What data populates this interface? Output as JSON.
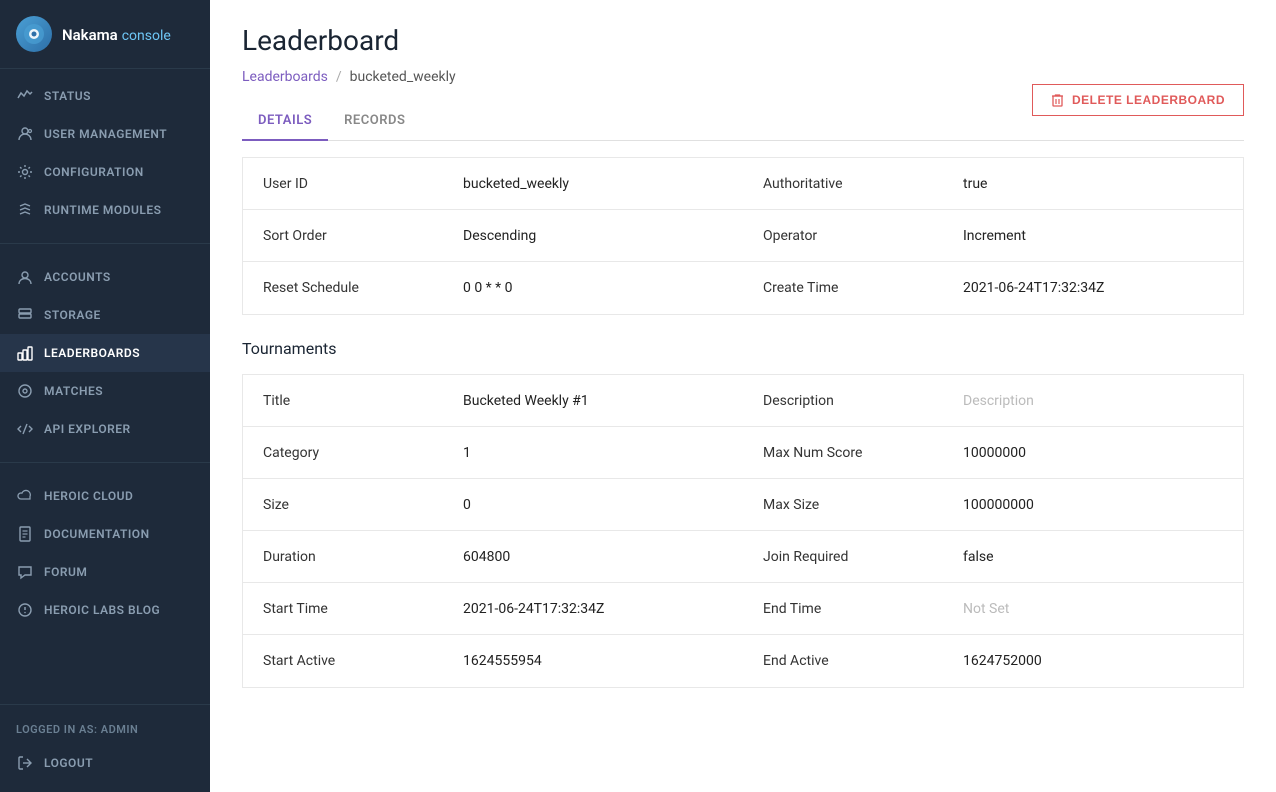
{
  "sidebar": {
    "logo": {
      "name": "Nakama",
      "suffix": "console"
    },
    "nav_items": [
      {
        "id": "status",
        "label": "Status",
        "icon": "〜"
      },
      {
        "id": "user-management",
        "label": "User Management",
        "icon": "⊕"
      },
      {
        "id": "configuration",
        "label": "Configuration",
        "icon": "⚙"
      },
      {
        "id": "runtime-modules",
        "label": "Runtime Modules",
        "icon": "</>"
      }
    ],
    "nav_items2": [
      {
        "id": "accounts",
        "label": "Accounts",
        "icon": "👤"
      },
      {
        "id": "storage",
        "label": "Storage",
        "icon": "▦"
      },
      {
        "id": "leaderboards",
        "label": "Leaderboards",
        "icon": "🏆"
      },
      {
        "id": "matches",
        "label": "Matches",
        "icon": "◎"
      },
      {
        "id": "api-explorer",
        "label": "API Explorer",
        "icon": "</>"
      }
    ],
    "nav_items3": [
      {
        "id": "heroic-cloud",
        "label": "Heroic Cloud",
        "icon": "☁"
      },
      {
        "id": "documentation",
        "label": "Documentation",
        "icon": "📄"
      },
      {
        "id": "forum",
        "label": "Forum",
        "icon": "💬"
      },
      {
        "id": "heroic-labs-blog",
        "label": "Heroic Labs Blog",
        "icon": "🔔"
      }
    ],
    "logged_in_label": "Logged In As: Admin",
    "logout_label": "Logout"
  },
  "page": {
    "title": "Leaderboard",
    "breadcrumb": {
      "link_label": "Leaderboards",
      "separator": "/",
      "current": "bucketed_weekly"
    },
    "delete_button": "DELETE LEADERBOARD",
    "tabs": [
      {
        "id": "details",
        "label": "Details",
        "active": true
      },
      {
        "id": "records",
        "label": "Records",
        "active": false
      }
    ]
  },
  "details": {
    "rows": [
      {
        "label1": "User ID",
        "value1": "bucketed_weekly",
        "label2": "Authoritative",
        "value2": "true"
      },
      {
        "label1": "Sort Order",
        "value1": "Descending",
        "label2": "Operator",
        "value2": "Increment"
      },
      {
        "label1": "Reset Schedule",
        "value1": "0 0 * * 0",
        "label2": "Create Time",
        "value2": "2021-06-24T17:32:34Z"
      }
    ]
  },
  "tournaments": {
    "section_title": "Tournaments",
    "rows": [
      {
        "label1": "Title",
        "value1": "Bucketed Weekly #1",
        "label2": "Description",
        "value2": "Description",
        "value2_placeholder": true
      },
      {
        "label1": "Category",
        "value1": "1",
        "label2": "Max Num Score",
        "value2": "10000000"
      },
      {
        "label1": "Size",
        "value1": "0",
        "label2": "Max Size",
        "value2": "100000000"
      },
      {
        "label1": "Duration",
        "value1": "604800",
        "label2": "Join Required",
        "value2": "false"
      },
      {
        "label1": "Start Time",
        "value1": "2021-06-24T17:32:34Z",
        "label2": "End Time",
        "value2": "Not Set",
        "value2_placeholder": true
      },
      {
        "label1": "Start Active",
        "value1": "1624555954",
        "label2": "End Active",
        "value2": "1624752000"
      }
    ]
  }
}
